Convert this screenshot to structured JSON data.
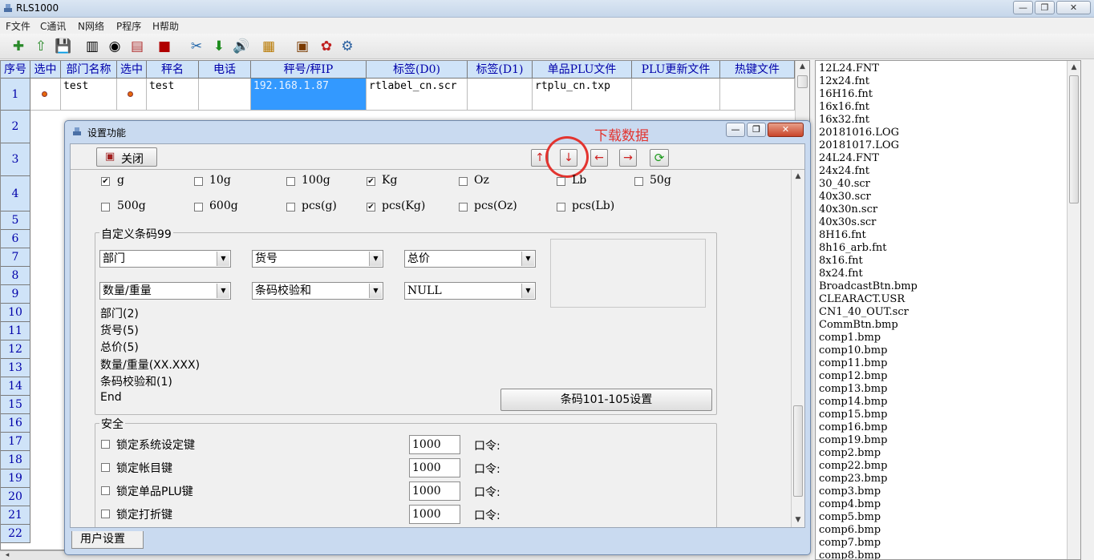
{
  "window": {
    "title": "RLS1000",
    "controls": [
      "—",
      "❐",
      "✕"
    ]
  },
  "menu": [
    "F文件",
    "C通讯",
    "N网络",
    "P程序",
    "H帮助"
  ],
  "grid": {
    "headers": [
      "序号",
      "选中",
      "部门名称",
      "选中",
      "秤名",
      "电话",
      "秤号/秤IP",
      "标签(D0)",
      "标签(D1)",
      "单品PLU文件",
      "PLU更新文件",
      "热键文件"
    ],
    "row": {
      "num": "1",
      "dept": "test",
      "scale": "test",
      "ip": "192.168.1.87",
      "label0": "rtlabel_cn.scr",
      "plu": "rtplu_cn.txp"
    },
    "row_numbers": [
      "2",
      "3",
      "4",
      "5",
      "6",
      "7",
      "8",
      "9",
      "10",
      "11",
      "12",
      "13",
      "14",
      "15",
      "16",
      "17",
      "18",
      "19",
      "20",
      "21",
      "22"
    ]
  },
  "files": [
    "12L24.FNT",
    "12x24.fnt",
    "16H16.fnt",
    "16x16.fnt",
    "16x32.fnt",
    "20181016.LOG",
    "20181017.LOG",
    "24L24.FNT",
    "24x24.fnt",
    "30_40.scr",
    "40x30.scr",
    "40x30n.scr",
    "40x30s.scr",
    "8H16.fnt",
    "8h16_arb.fnt",
    "8x16.fnt",
    "8x24.fnt",
    "BroadcastBtn.bmp",
    "CLEARACT.USR",
    "CN1_40_OUT.scr",
    "CommBtn.bmp",
    "comp1.bmp",
    "comp10.bmp",
    "comp11.bmp",
    "comp12.bmp",
    "comp13.bmp",
    "comp14.bmp",
    "comp15.bmp",
    "comp16.bmp",
    "comp19.bmp",
    "comp2.bmp",
    "comp22.bmp",
    "comp23.bmp",
    "comp3.bmp",
    "comp4.bmp",
    "comp5.bmp",
    "comp6.bmp",
    "comp7.bmp",
    "comp8.bmp"
  ],
  "dialog": {
    "title": "设置功能",
    "close_label": "关闭",
    "annotation": "下载数据",
    "units_row1": [
      {
        "label": "g",
        "checked": true
      },
      {
        "label": "10g",
        "checked": false
      },
      {
        "label": "100g",
        "checked": false
      },
      {
        "label": "Kg",
        "checked": true
      },
      {
        "label": "Oz",
        "checked": false
      },
      {
        "label": "Lb",
        "checked": false
      },
      {
        "label": "50g",
        "checked": false
      }
    ],
    "units_row2": [
      {
        "label": "500g",
        "checked": false
      },
      {
        "label": "600g",
        "checked": false
      },
      {
        "label": "pcs(g)",
        "checked": false
      },
      {
        "label": "pcs(Kg)",
        "checked": true
      },
      {
        "label": "pcs(Oz)",
        "checked": false
      },
      {
        "label": "pcs(Lb)",
        "checked": false
      }
    ],
    "barcode_group": "自定义条码99",
    "combos": [
      "部门",
      "货号",
      "总价",
      "数量/重量",
      "条码校验和",
      "NULL"
    ],
    "barcode_lines": [
      "部门(2)",
      "货号(5)",
      "总价(5)",
      "数量/重量(XX.XXX)",
      "条码校验和(1)",
      "End"
    ],
    "barcode_button": "条码101-105设置",
    "security_group": "安全",
    "security": [
      {
        "label": "锁定系统设定键",
        "value": "1000",
        "pw_label": "口令:"
      },
      {
        "label": "锁定帐目键",
        "value": "1000",
        "pw_label": "口令:"
      },
      {
        "label": "锁定单品PLU键",
        "value": "1000",
        "pw_label": "口令:"
      },
      {
        "label": "锁定打折键",
        "value": "1000",
        "pw_label": "口令:"
      }
    ],
    "tab": "用户设置"
  },
  "colors": {
    "header_bg": "#cfe3f8",
    "selected_cell": "#3399ff",
    "annotation": "#e3342f"
  }
}
